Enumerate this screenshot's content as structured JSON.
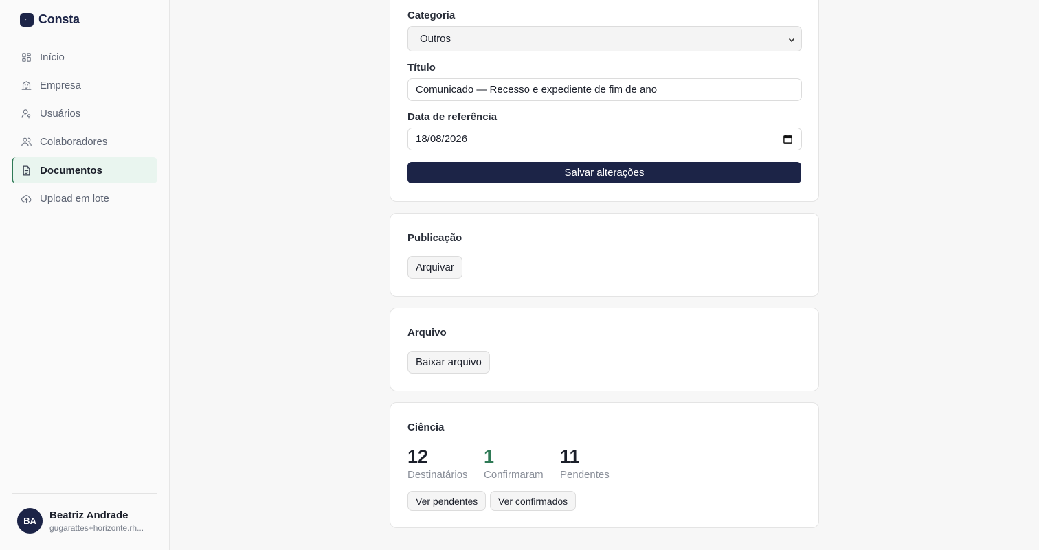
{
  "brand": {
    "name": "Consta",
    "logo_icon": "consta-logo-icon"
  },
  "sidebar": {
    "items": [
      {
        "label": "Início",
        "icon": "dashboard-grid-icon",
        "active": false
      },
      {
        "label": "Empresa",
        "icon": "building-icon",
        "active": false
      },
      {
        "label": "Usuários",
        "icon": "user-key-icon",
        "active": false
      },
      {
        "label": "Colaboradores",
        "icon": "users-icon",
        "active": false
      },
      {
        "label": "Documentos",
        "icon": "document-icon",
        "active": true
      },
      {
        "label": "Upload em lote",
        "icon": "cloud-upload-icon",
        "active": false
      }
    ]
  },
  "user": {
    "initials": "BA",
    "name": "Beatriz Andrade",
    "email": "gugarattes+horizonte.rh..."
  },
  "form": {
    "category_label": "Categoria",
    "category_value": "Outros",
    "title_label": "Título",
    "title_value": "Comunicado — Recesso e expediente de fim de ano",
    "date_label": "Data de referência",
    "date_value": "18/08/2026",
    "save_label": "Salvar alterações"
  },
  "publication": {
    "title": "Publicação",
    "archive_label": "Arquivar"
  },
  "file": {
    "title": "Arquivo",
    "download_label": "Baixar arquivo"
  },
  "acknowledgement": {
    "title": "Ciência",
    "recipients_count": "12",
    "recipients_label": "Destinatários",
    "confirmed_count": "1",
    "confirmed_label": "Confirmaram",
    "pending_count": "11",
    "pending_label": "Pendentes",
    "view_pending_label": "Ver pendentes",
    "view_confirmed_label": "Ver confirmados"
  },
  "colors": {
    "brand": "#1c2447",
    "active_bg": "#e9f5ef",
    "active_border": "#2f7a56",
    "confirmed_green": "#2f7a56"
  }
}
